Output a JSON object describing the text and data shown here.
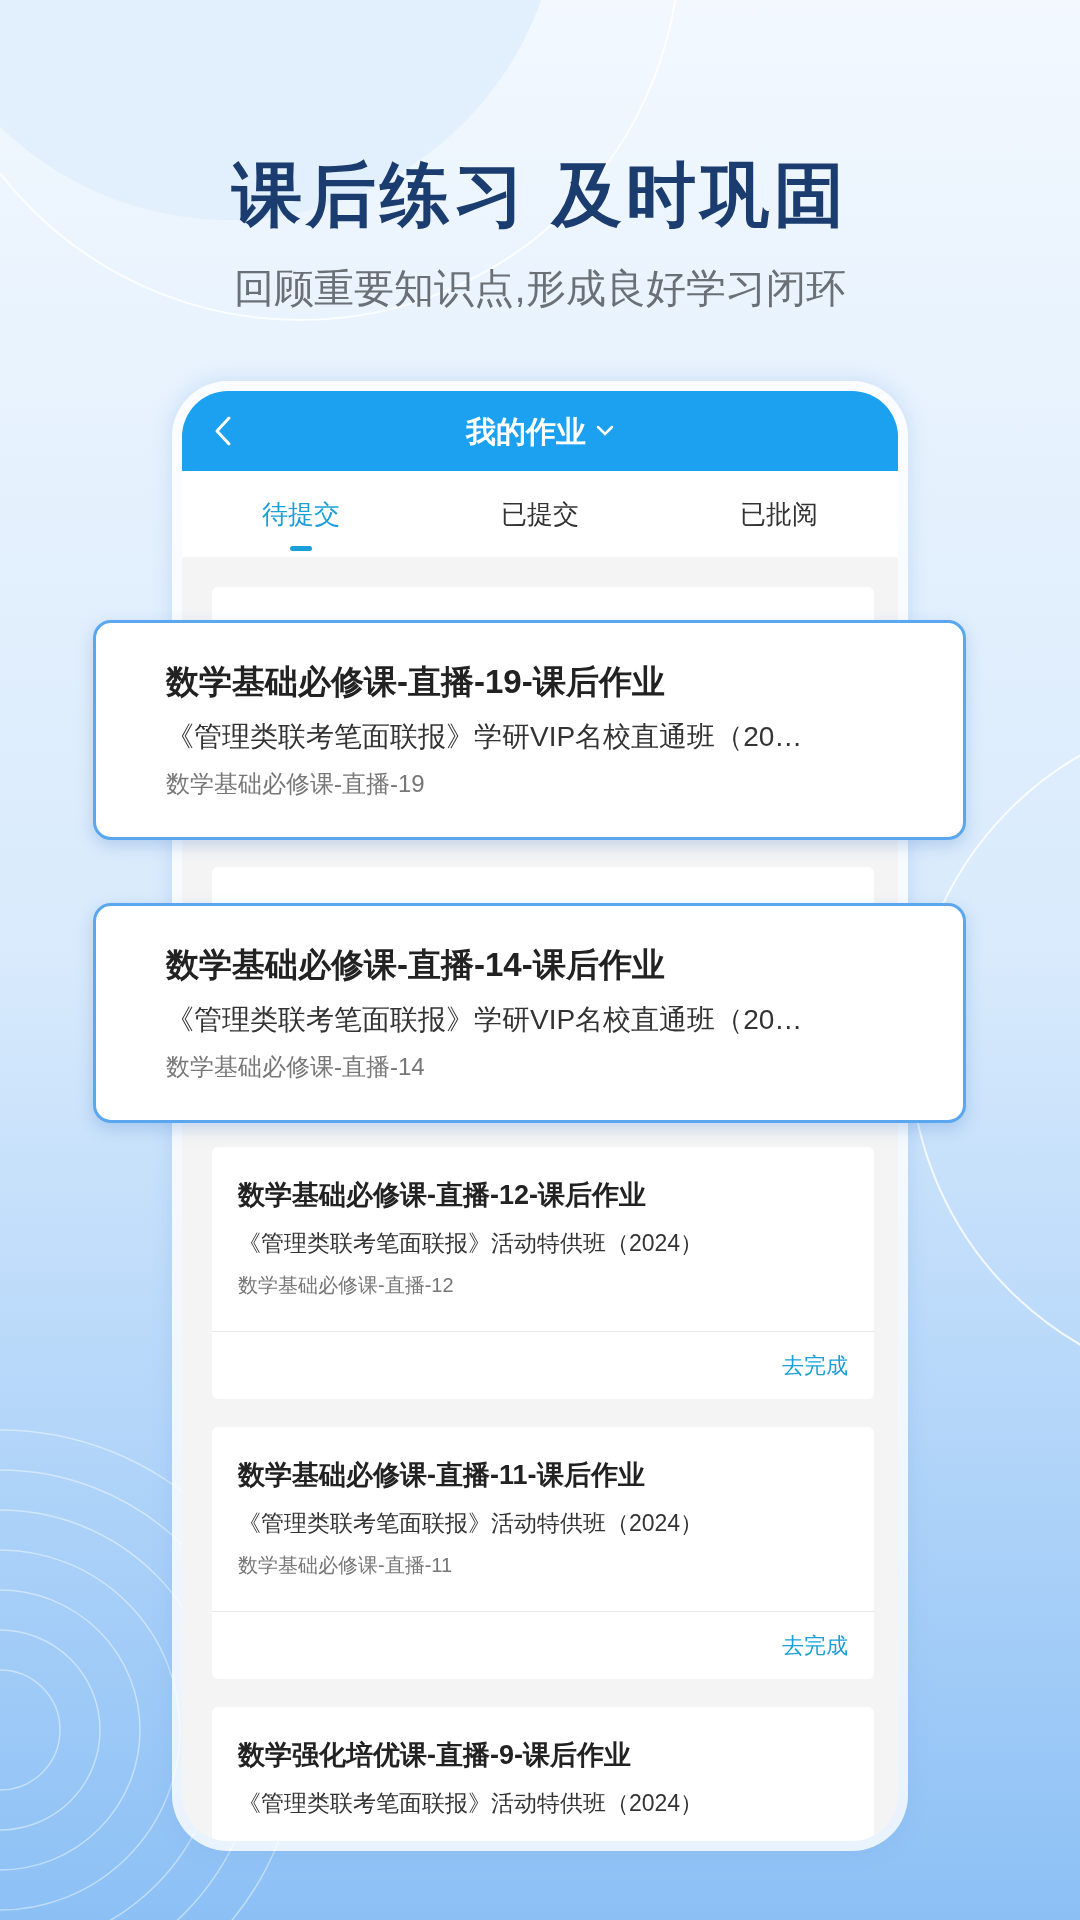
{
  "heading": {
    "title": "课后练习 及时巩固",
    "subtitle": "回顾重要知识点,形成良好学习闭环"
  },
  "app": {
    "header": {
      "title": "我的作业"
    },
    "tabs": [
      {
        "label": "待提交",
        "selected": true
      },
      {
        "label": "已提交",
        "selected": false
      },
      {
        "label": "已批阅",
        "selected": false
      }
    ],
    "cards": [
      {
        "kind": "highlighted",
        "title": "数学基础必修课-直播-19-课后作业",
        "course": "《管理类联考笔面联报》学研VIP名校直通班（20…",
        "lesson": "数学基础必修课-直播-19"
      },
      {
        "kind": "highlighted",
        "title": "数学基础必修课-直播-14-课后作业",
        "course": "《管理类联考笔面联报》学研VIP名校直通班（20…",
        "lesson": "数学基础必修课-直播-14"
      },
      {
        "kind": "normal",
        "title": "数学基础必修课-直播-12-课后作业",
        "course": "《管理类联考笔面联报》活动特供班（2024）",
        "lesson": "数学基础必修课-直播-12",
        "action": "去完成"
      },
      {
        "kind": "normal",
        "title": "数学基础必修课-直播-11-课后作业",
        "course": "《管理类联考笔面联报》活动特供班（2024）",
        "lesson": "数学基础必修课-直播-11",
        "action": "去完成"
      },
      {
        "kind": "normal",
        "title": "数学强化培优课-直播-9-课后作业",
        "course": "《管理类联考笔面联报》活动特供班（2024）"
      }
    ]
  }
}
